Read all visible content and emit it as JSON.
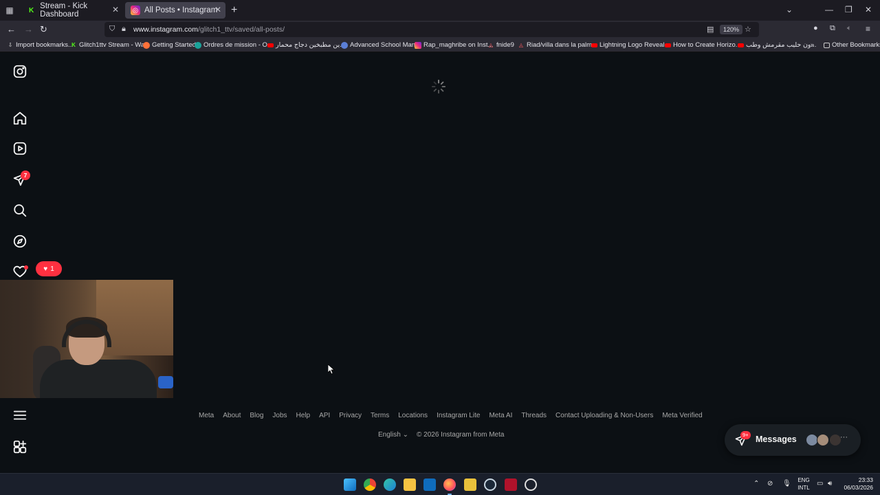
{
  "browser": {
    "tabs": [
      {
        "title": "Stream - Kick Dashboard",
        "active": false
      },
      {
        "title": "All Posts • Instagram",
        "active": true
      }
    ],
    "url_host": "www.instagram.com",
    "url_path": "/glitch1_ttv/saved/all-posts/",
    "zoom": "120%",
    "bookmarks": [
      "Import bookmarks...",
      "Glitch1ttv Stream - Wa...",
      "Getting Started",
      "Ordres de mission - O...",
      "ين مطبخين دجاج محمار...",
      "Advanced School Man...",
      "Rap_maghribe on Inst...",
      "fnide9",
      "Riad/villa dans la palm...",
      "Lightning Logo Reveal...",
      "How to Create Horizo...",
      "ون حليب مقرمش وطب..."
    ],
    "other_bookmarks": "Other Bookmarks"
  },
  "instagram": {
    "notifications_count": "7",
    "likes_count": "1",
    "footer_links": [
      "Meta",
      "About",
      "Blog",
      "Jobs",
      "Help",
      "API",
      "Privacy",
      "Terms",
      "Locations",
      "Instagram Lite",
      "Meta AI",
      "Threads",
      "Contact Uploading & Non-Users",
      "Meta Verified"
    ],
    "language": "English",
    "copyright": "© 2026 Instagram from Meta",
    "messages_label": "Messages",
    "messages_badge": "9+"
  },
  "taskbar": {
    "lang_line1": "ENG",
    "lang_line2": "INTL",
    "time": "23:33",
    "date": "06/03/2026"
  },
  "colors": {
    "background": "#0c1014",
    "notification_red": "#ff3040",
    "browser_chrome": "#2b2a33"
  }
}
